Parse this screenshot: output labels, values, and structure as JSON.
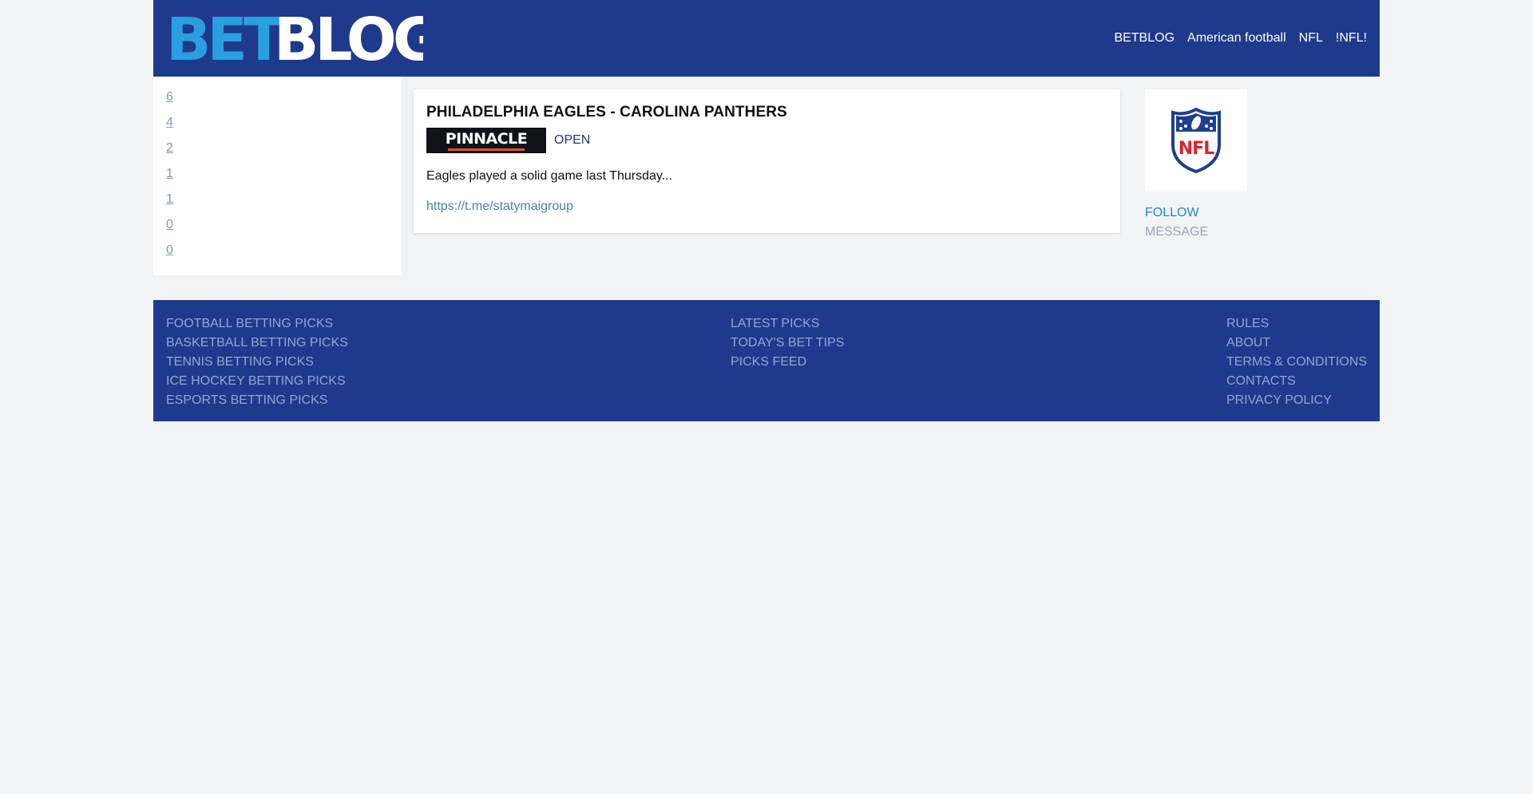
{
  "header": {
    "logo": {
      "part1": "BET",
      "part2": "BLOG",
      "color1": "#2a9fe0",
      "color2": "#ffffff"
    },
    "nav": [
      "BETBLOG",
      "American football",
      "NFL",
      "!NFL!"
    ]
  },
  "sidebar": {
    "numbers": [
      "6",
      "4",
      "2",
      "1",
      "1",
      "0",
      "0"
    ]
  },
  "pick": {
    "title": "PHILADELPHIA EAGLES - CAROLINA PANTHERS",
    "bookmaker": "PINNACLE",
    "status": "OPEN",
    "text": "Eagles played a solid game last Thursday...",
    "link": "https://t.me/statymaigroup"
  },
  "profile": {
    "avatar_icon": "nfl-shield-icon",
    "follow": "FOLLOW",
    "message": "MESSAGE"
  },
  "footer": {
    "col1": [
      "FOOTBALL BETTING PICKS",
      "BASKETBALL BETTING PICKS",
      "TENNIS BETTING PICKS",
      "ICE HOCKEY BETTING PICKS",
      "ESPORTS BETTING PICKS"
    ],
    "col2": [
      "LATEST PICKS",
      "TODAY'S BET TIPS",
      "PICKS FEED"
    ],
    "col3": [
      "RULES",
      "ABOUT",
      "TERMS & CONDITIONS",
      "CONTACTS",
      "PRIVACY POLICY"
    ]
  },
  "colors": {
    "header_bg": "#1f3a8c",
    "page_bg": "#f2f3f5",
    "accent_link": "#1e88c9",
    "footer_link": "#8fa7d6"
  }
}
